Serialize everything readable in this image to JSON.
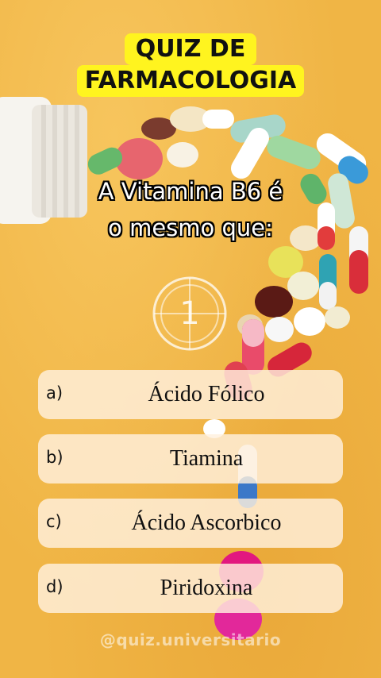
{
  "title": {
    "line1": "QUIZ DE",
    "line2": "FARMACOLOGIA"
  },
  "question": {
    "line1": "A Vitamina B6 é",
    "line2": "o mesmo que:"
  },
  "timer": {
    "value": "1"
  },
  "answers": [
    {
      "letter": "a)",
      "text": "Ácido Fólico"
    },
    {
      "letter": "b)",
      "text": "Tiamina"
    },
    {
      "letter": "c)",
      "text": "Ácido Ascorbico"
    },
    {
      "letter": "d)",
      "text": "Piridoxina"
    }
  ],
  "watermark": "@quiz.universitario",
  "colors": {
    "background": "#f0b545",
    "title_highlight": "#fff41f",
    "answer_card": "#fff0de",
    "question_text": "#ffffff"
  }
}
